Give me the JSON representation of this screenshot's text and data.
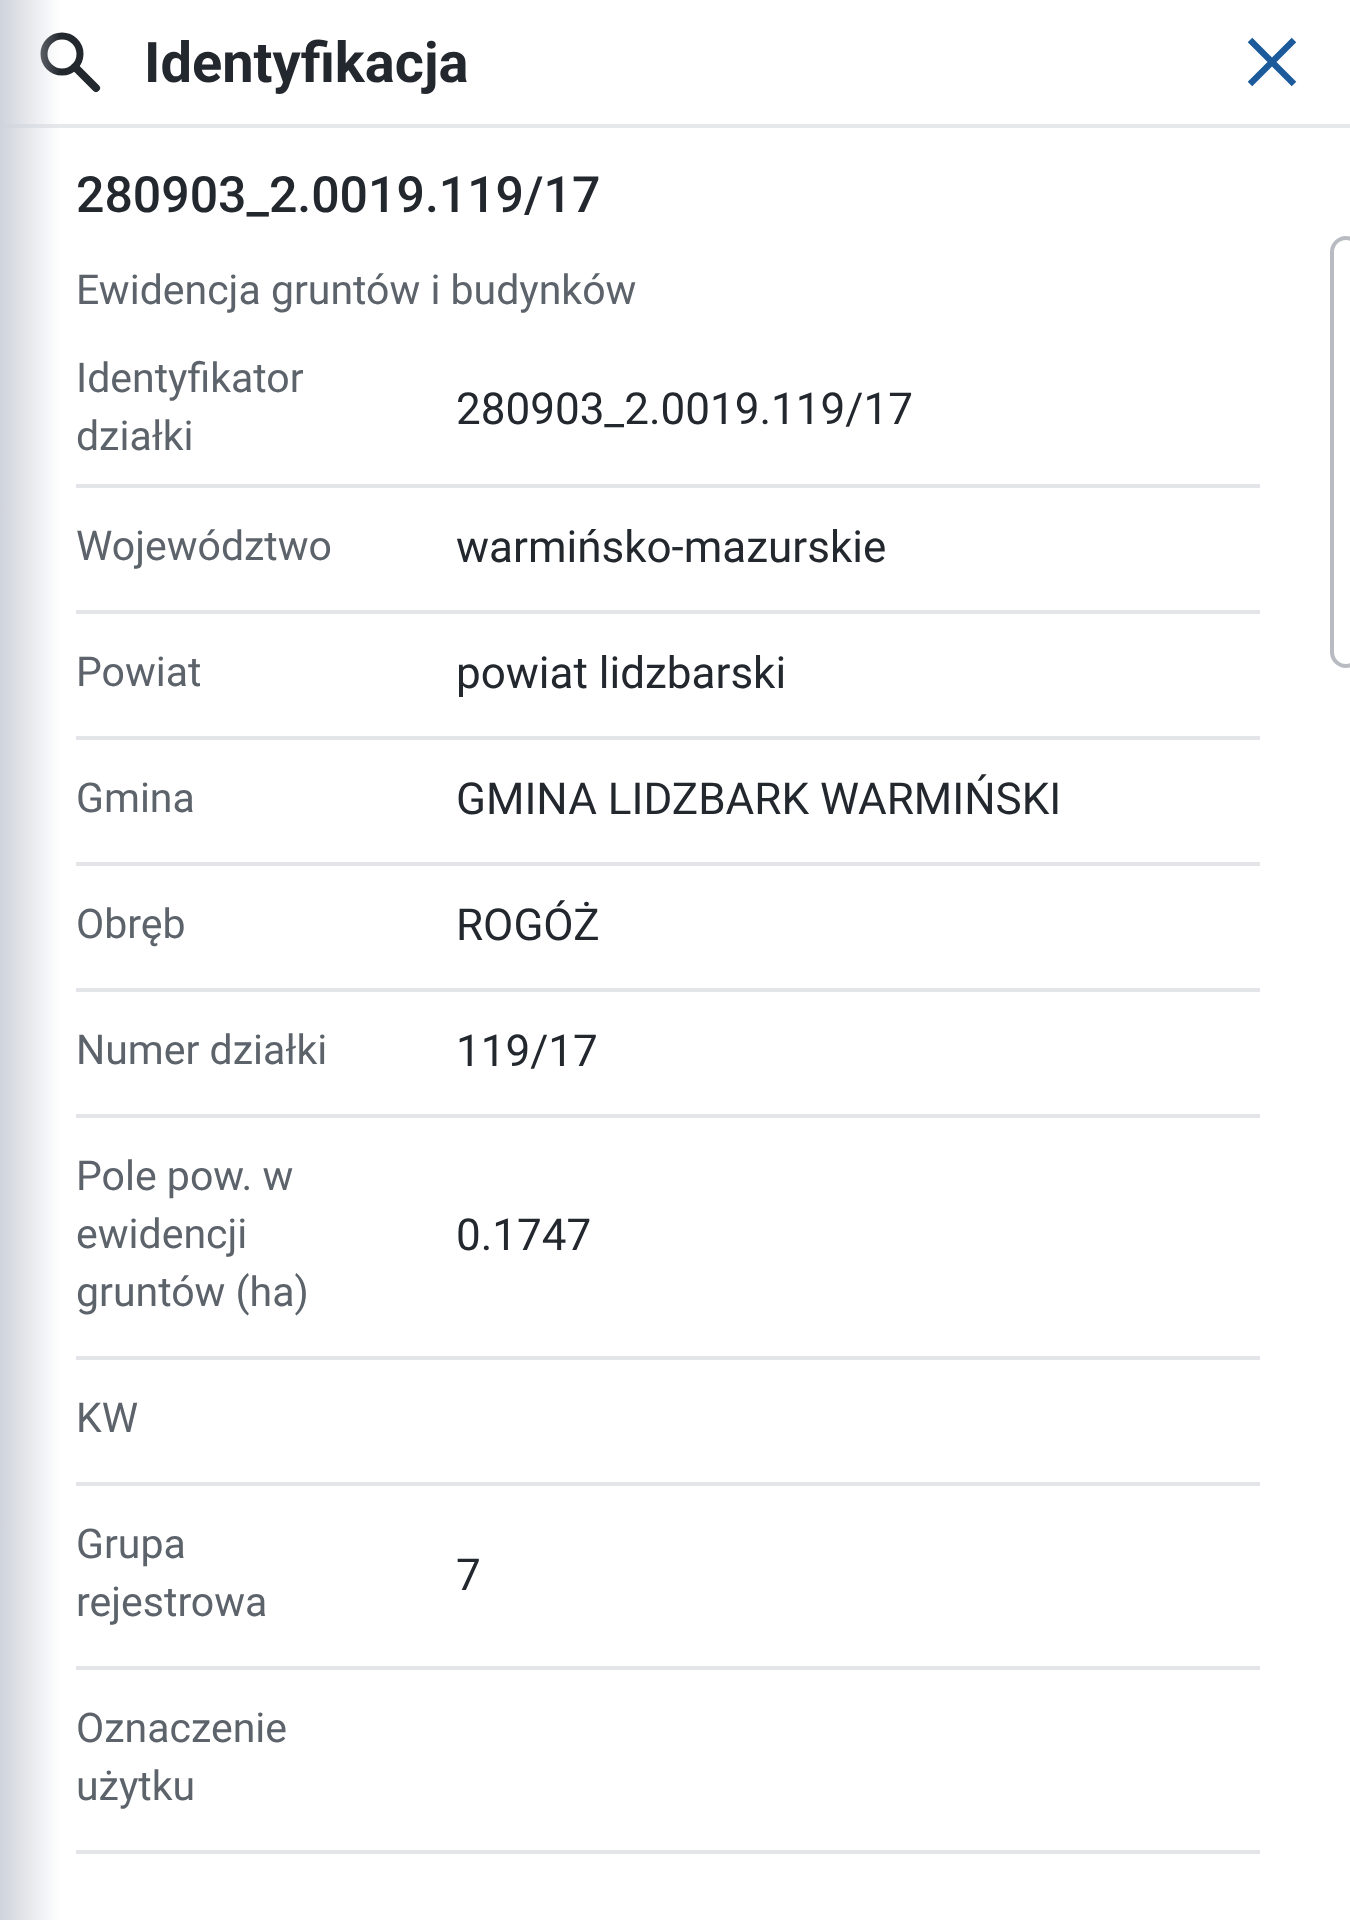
{
  "header": {
    "title": "Identyfikacja"
  },
  "parcel": {
    "title": "280903_2.0019.119/17",
    "source": "Ewidencja gruntów i budynków"
  },
  "rows": [
    {
      "label": "Identyfikator działki",
      "value": "280903_2.0019.119/17"
    },
    {
      "label": "Województwo",
      "value": "warmińsko-mazurskie"
    },
    {
      "label": "Powiat",
      "value": "powiat lidzbarski"
    },
    {
      "label": "Gmina",
      "value": "GMINA LIDZBARK WARMIŃSKI"
    },
    {
      "label": "Obręb",
      "value": "ROGÓŻ"
    },
    {
      "label": "Numer działki",
      "value": "119/17"
    },
    {
      "label": "Pole pow. w ewidencji gruntów (ha)",
      "value": "0.1747"
    },
    {
      "label": "KW"
    },
    {
      "label": "Grupa rejestrowa",
      "value": "7"
    },
    {
      "label": "Oznaczenie użytku"
    }
  ]
}
